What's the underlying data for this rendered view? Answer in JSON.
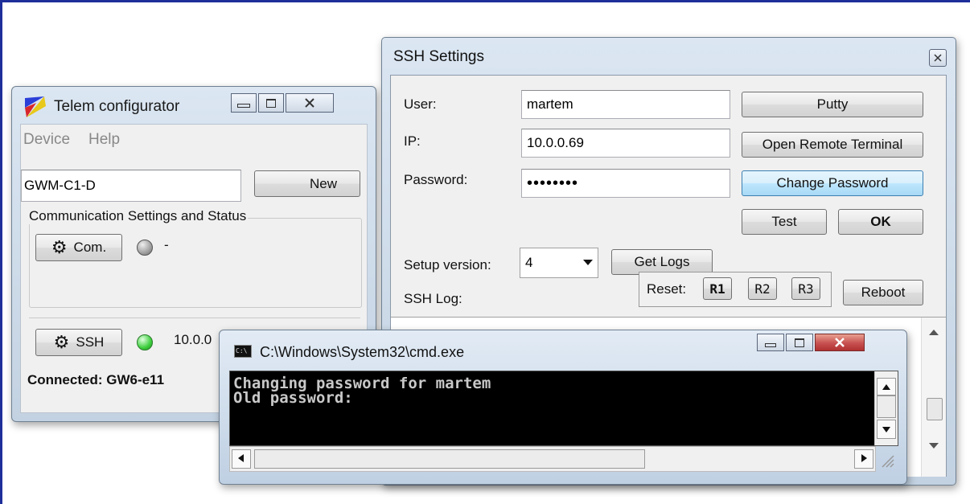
{
  "telem": {
    "title": "Telem configurator",
    "menu": [
      "Device",
      "Help"
    ],
    "device_value": "GWM-C1-D",
    "new_label": "New",
    "group_label": "Communication Settings and Status",
    "com_label": "Com.",
    "com_status": "-",
    "ssh_label": "SSH",
    "ssh_status": "10.0.0",
    "connected_text": "Connected: GW6-e11"
  },
  "ssh": {
    "title": "SSH Settings",
    "user_label": "User:",
    "user_value": "martem",
    "ip_label": "IP:",
    "ip_value": "10.0.0.69",
    "password_label": "Password:",
    "password_value": "••••••••",
    "putty_label": "Putty",
    "open_terminal_label": "Open Remote Terminal",
    "change_password_label": "Change Password",
    "test_label": "Test",
    "ok_label": "OK",
    "setup_version_label": "Setup version:",
    "setup_version_value": "4",
    "get_logs_label": "Get Logs",
    "ssh_log_label": "SSH Log:",
    "reset_label": "Reset:",
    "r1_label": "R1",
    "r2_label": "R2",
    "r3_label": "R3",
    "reboot_label": "Reboot"
  },
  "cmd": {
    "title": "C:\\Windows\\System32\\cmd.exe",
    "icon_text": "C:\\",
    "lines": [
      "Changing password for martem",
      "Old password:"
    ]
  },
  "colors": {
    "cmd_close": "#c75050",
    "led_gray": "#a0a0a0",
    "led_green": "#3ecf3e",
    "frame": "#1e2f9a"
  }
}
